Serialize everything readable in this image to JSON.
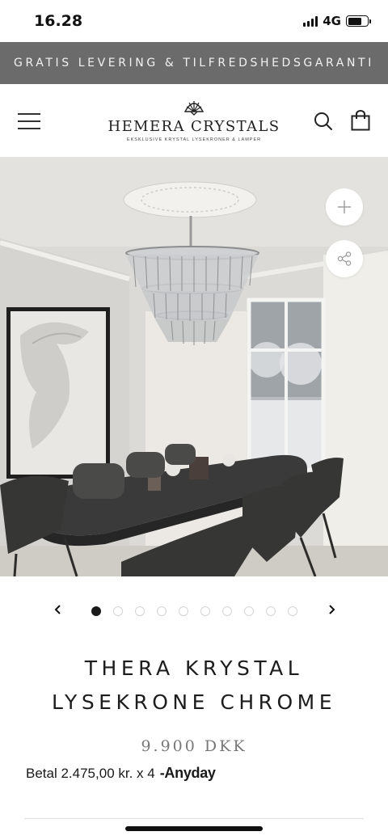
{
  "status_bar": {
    "time": "16.28",
    "network": "4G",
    "battery_level": 0.7
  },
  "promo": {
    "text": "GRATIS LEVERING & TILFREDSHEDSGARANTI",
    "background": "#6b6b6b"
  },
  "header": {
    "menu_icon": "hamburger-menu-icon",
    "logo_mark": "shell-icon",
    "brand_name": "HEMERA CRYSTALS",
    "brand_tagline": "EKSKLUSIVE KRYSTAL LYSEKRONER & LAMPER",
    "search_icon": "search-icon",
    "cart_icon": "shopping-bag-icon"
  },
  "gallery": {
    "zoom_icon": "plus-icon",
    "share_icon": "share-icon",
    "prev_icon": "chevron-left-icon",
    "next_icon": "chevron-right-icon",
    "total_images": 10,
    "active_index": 0
  },
  "product": {
    "title_line1": "THERA KRYSTAL",
    "title_line2": "LYSEKRONE CHROME",
    "price": "9.900 DKK",
    "installment_text": "Betal 2.475,00 kr. x 4",
    "installment_provider": "Anyday"
  }
}
